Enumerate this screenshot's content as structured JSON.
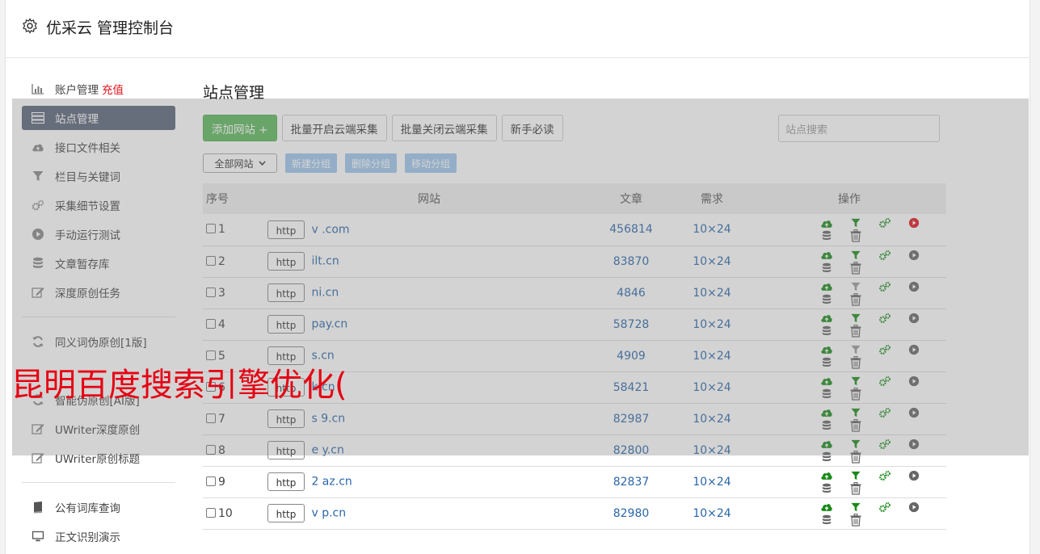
{
  "header": {
    "title": "优采云 管理控制台"
  },
  "sidebar": {
    "items": [
      {
        "label": "账户管理",
        "extra": "充值",
        "icon": "bar-chart-icon"
      },
      {
        "label": "站点管理",
        "icon": "server-icon",
        "active": true
      },
      {
        "label": "接口文件相关",
        "icon": "cloud-upload-icon"
      },
      {
        "label": "栏目与关键词",
        "icon": "filter-icon"
      },
      {
        "label": "采集细节设置",
        "icon": "gears-icon"
      },
      {
        "label": "手动运行测试",
        "icon": "play-icon"
      },
      {
        "label": "文章暂存库",
        "icon": "database-icon"
      },
      {
        "label": "深度原创任务",
        "icon": "edit-icon"
      }
    ],
    "group2": [
      {
        "label": "同义词伪原创[1版]",
        "icon": "refresh-icon"
      },
      {
        "label": "智能伪原创[AI版]",
        "icon": "refresh-icon"
      },
      {
        "label": "UWriter深度原创",
        "icon": "edit-icon"
      },
      {
        "label": "UWriter原创标题",
        "icon": "edit-icon"
      }
    ],
    "group3": [
      {
        "label": "公有词库查询",
        "icon": "book-icon"
      },
      {
        "label": "正文识别演示",
        "icon": "monitor-icon"
      }
    ]
  },
  "main": {
    "title": "站点管理",
    "toolbar": {
      "add_site": "添加网站 +",
      "batch_open": "批量开启云端采集",
      "batch_close": "批量关闭云端采集",
      "newbie": "新手必读",
      "search_placeholder": "站点搜索"
    },
    "group_select": "全部网站",
    "group_buttons": {
      "new_group": "新建分组",
      "delete_group": "删除分组",
      "move_group": "移动分组"
    },
    "table": {
      "headers": {
        "no": "序号",
        "site": "网站",
        "articles": "文章",
        "demand": "需求",
        "ops": "操作"
      },
      "rows": [
        {
          "no": "1",
          "protocol": "http",
          "site": "v .com",
          "articles": "456814",
          "demand": "10×24",
          "play_active": true,
          "filter_active": true
        },
        {
          "no": "2",
          "protocol": "http",
          "site": "ilt.cn",
          "articles": "83870",
          "demand": "10×24",
          "play_active": false,
          "filter_active": true
        },
        {
          "no": "3",
          "protocol": "http",
          "site": "ni.cn",
          "articles": "4846",
          "demand": "10×24",
          "play_active": false,
          "filter_active": false
        },
        {
          "no": "4",
          "protocol": "http",
          "site": "pay.cn",
          "articles": "58728",
          "demand": "10×24",
          "play_active": false,
          "filter_active": true
        },
        {
          "no": "5",
          "protocol": "http",
          "site": "s.cn",
          "articles": "4909",
          "demand": "10×24",
          "play_active": false,
          "filter_active": false
        },
        {
          "no": "6",
          "protocol": "http",
          "site": "k.cn",
          "articles": "58421",
          "demand": "10×24",
          "play_active": false,
          "filter_active": true
        },
        {
          "no": "7",
          "protocol": "http",
          "site": "s 9.cn",
          "articles": "82987",
          "demand": "10×24",
          "play_active": false,
          "filter_active": true
        },
        {
          "no": "8",
          "protocol": "http",
          "site": "e y.cn",
          "articles": "82800",
          "demand": "10×24",
          "play_active": false,
          "filter_active": true
        },
        {
          "no": "9",
          "protocol": "http",
          "site": "2 az.cn",
          "articles": "82837",
          "demand": "10×24",
          "play_active": false,
          "filter_active": true
        },
        {
          "no": "10",
          "protocol": "http",
          "site": "v p.cn",
          "articles": "82980",
          "demand": "10×24",
          "play_active": false,
          "filter_active": true
        }
      ]
    }
  },
  "watermark": "昆明百度搜索引擎优化(",
  "colors": {
    "active_nav": "#5a6478",
    "green_button": "#5cb85c",
    "link_blue": "#2a66a8",
    "red": "#e3111b",
    "op_green": "#1a8a1a"
  }
}
